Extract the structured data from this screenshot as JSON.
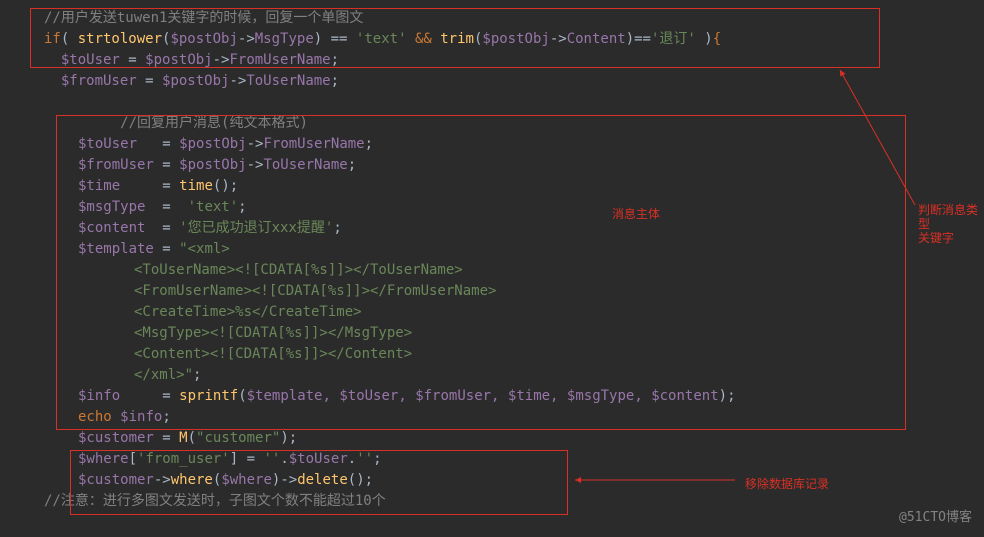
{
  "code": {
    "l1_comment": "//用户发送tuwen1关键字的时候，回复一个单图文",
    "l2_if": "if",
    "l2_func1": "strtolower",
    "l2_var1": "$postObj",
    "l2_prop1": "MsgType",
    "l2_str1": "'text'",
    "l2_and": "&&",
    "l2_func2": "trim",
    "l2_prop2": "Content",
    "l2_str2": "'退订'",
    "l3_var1": "$toUser",
    "l3_var2": "$postObj",
    "l3_prop": "FromUserName",
    "l4_var1": "$fromUser",
    "l4_prop": "ToUserName",
    "l5_comment": "//回复用户消息(纯文本格式)",
    "l6_var": "$toUser",
    "l6_prop": "FromUserName",
    "l7_var": "$fromUser",
    "l7_prop": "ToUserName",
    "l8_var": "$time",
    "l8_func": "time",
    "l9_var": "$msgType",
    "l9_str": "'text'",
    "l10_var": "$content",
    "l10_str": "'您已成功退订xxx提醒'",
    "l11_var": "$template",
    "l11_str": "\"<xml>",
    "l12": "<ToUserName><![CDATA[%s]]></ToUserName>",
    "l13": "<FromUserName><![CDATA[%s]]></FromUserName>",
    "l14": "<CreateTime>%s</CreateTime>",
    "l15": "<MsgType><![CDATA[%s]]></MsgType>",
    "l16": "<Content><![CDATA[%s]]></Content>",
    "l17": "</xml>\"",
    "l18_var": "$info",
    "l18_func": "sprintf",
    "l18_args": "$template, $toUser, $fromUser, $time, $msgType, $content",
    "l19_echo": "echo",
    "l19_var": "$info",
    "l20_var": "$customer",
    "l20_func": "M",
    "l20_str": "\"customer\"",
    "l21_var": "$where",
    "l21_key": "'from_user'",
    "l21_val1": "''",
    "l21_val2": "$toUser",
    "l21_val3": "''",
    "l22_var": "$customer",
    "l22_m1": "where",
    "l22_arg": "$where",
    "l22_m2": "delete",
    "l23_comment": "//注意：进行多图文发送时，子图文个数不能超过10个"
  },
  "annotations": {
    "a1": "消息主体",
    "a2": "判断消息类型\n关键字",
    "a3": "移除数据库记录"
  },
  "watermark": "@51CTO博客"
}
